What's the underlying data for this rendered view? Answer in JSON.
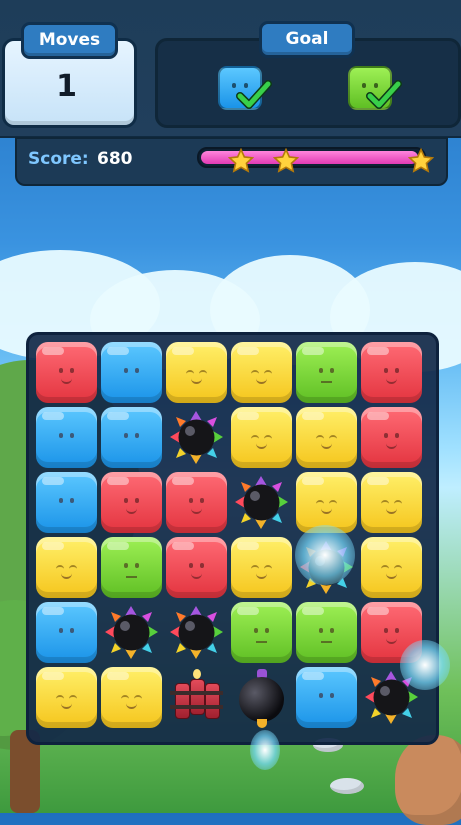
{
  "hud": {
    "moves_label": "Moves",
    "moves_value": "1",
    "goal_label": "Goal",
    "goals": [
      {
        "color": "blue",
        "status": "completed",
        "icon": "blue-block-check-icon"
      },
      {
        "color": "green",
        "status": "completed",
        "icon": "green-block-check-icon"
      }
    ],
    "score_label": "Score:",
    "score_value": "680",
    "progress_fraction": 0.98,
    "stars_earned": 3
  },
  "colors": {
    "red": "#e3343f",
    "blue": "#1a93e8",
    "yellow": "#f5c51c",
    "green": "#5fbf24",
    "progress": "#e23bb4",
    "panel": "#1e3d59"
  },
  "board": {
    "rows": 6,
    "cols": 6,
    "cells": [
      [
        "red",
        "blue",
        "yellow",
        "yellow",
        "green",
        "red"
      ],
      [
        "blue",
        "blue",
        "bomb",
        "yellow",
        "yellow",
        "red"
      ],
      [
        "blue",
        "red",
        "red",
        "bomb",
        "yellow",
        "yellow"
      ],
      [
        "yellow",
        "green",
        "red",
        "yellow",
        "bomb",
        "yellow"
      ],
      [
        "blue",
        "bomb",
        "bomb",
        "green",
        "green",
        "red"
      ],
      [
        "yellow",
        "yellow",
        "dynamite",
        "black-bomb",
        "blue",
        "bomb"
      ]
    ]
  }
}
